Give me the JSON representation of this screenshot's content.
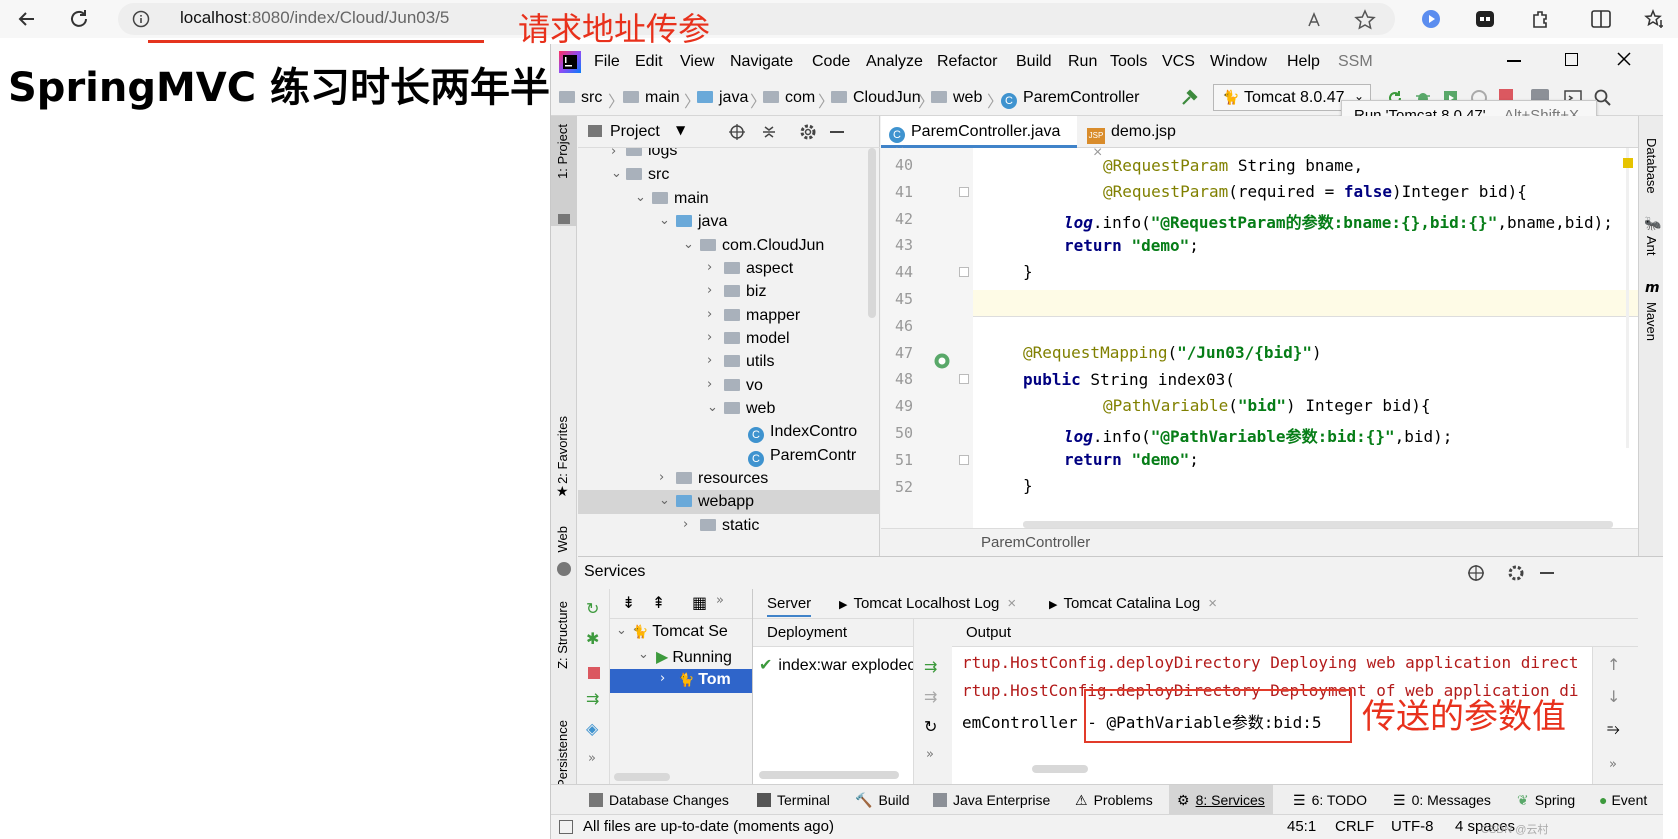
{
  "browser": {
    "url_host": "localhost",
    "url_path": ":8080/index/Cloud/Jun03/5",
    "annotation_url": "请求地址传参"
  },
  "page": {
    "heading": "SpringMVC 练习时长两年半"
  },
  "ide": {
    "menu": [
      "File",
      "Edit",
      "View",
      "Navigate",
      "Code",
      "Analyze",
      "Refactor",
      "Build",
      "Run",
      "Tools",
      "VCS",
      "Window",
      "Help",
      "SSM"
    ],
    "breadcrumbs": [
      "src",
      "main",
      "java",
      "com",
      "CloudJun",
      "web",
      "ParemController"
    ],
    "run_config": "Tomcat 8.0.47",
    "tooltip_label": "Run 'Tomcat 8.0.47'",
    "tooltip_shortcut": "Alt+Shift+X",
    "left_strip": [
      "1: Project",
      "2: Favorites",
      "Web",
      "Z: Structure",
      "Persistence"
    ],
    "right_strip": [
      "Database",
      "Ant",
      "Maven"
    ],
    "project_panel": {
      "title": "Project",
      "tree": [
        {
          "label": "logs"
        },
        {
          "label": "src"
        },
        {
          "label": "main"
        },
        {
          "label": "java"
        },
        {
          "label": "com.CloudJun"
        },
        {
          "label": "aspect"
        },
        {
          "label": "biz"
        },
        {
          "label": "mapper"
        },
        {
          "label": "model"
        },
        {
          "label": "utils"
        },
        {
          "label": "vo"
        },
        {
          "label": "web"
        },
        {
          "label": "IndexContro"
        },
        {
          "label": "ParemContr"
        },
        {
          "label": "resources"
        },
        {
          "label": "webapp"
        },
        {
          "label": "static"
        }
      ]
    },
    "editor": {
      "tabs": [
        "ParemController.java",
        "demo.jsp"
      ],
      "line_numbers": [
        "40",
        "41",
        "42",
        "43",
        "44",
        "45",
        "46",
        "47",
        "48",
        "49",
        "50",
        "51",
        "52"
      ],
      "class_crumb": "ParemController"
    },
    "services": {
      "title": "Services",
      "tree": [
        "Tomcat Se",
        "Running",
        "Tom"
      ],
      "tabs": [
        "Server",
        "Tomcat Localhost Log",
        "Tomcat Catalina Log"
      ],
      "deployment_header": "Deployment",
      "deployment_item": "index:war explodec",
      "output_header": "Output",
      "output_lines": [
        "rtup.HostConfig.deployDirectory Deploying web application direct",
        "rtup.HostConfig.deployDirectory Deployment of web application di",
        "emController - @PathVariable参数:bid:5"
      ],
      "annotation": "传送的参数值"
    },
    "bottom_tools": [
      "Database Changes",
      "Terminal",
      "Build",
      "Java Enterprise",
      "Problems",
      "8: Services",
      "6: TODO",
      "0: Messages",
      "Spring",
      "Event"
    ],
    "status": {
      "message": "All files are up-to-date (moments ago)",
      "position": "45:1",
      "line_sep": "CRLF",
      "encoding": "UTF-8",
      "indent": "4 spaces",
      "watermark": "CSDN @云村"
    }
  },
  "colors": {
    "annotation_red": "#e8311c",
    "selection_blue": "#2f65ca",
    "ide_bg": "#f2f2f2"
  }
}
